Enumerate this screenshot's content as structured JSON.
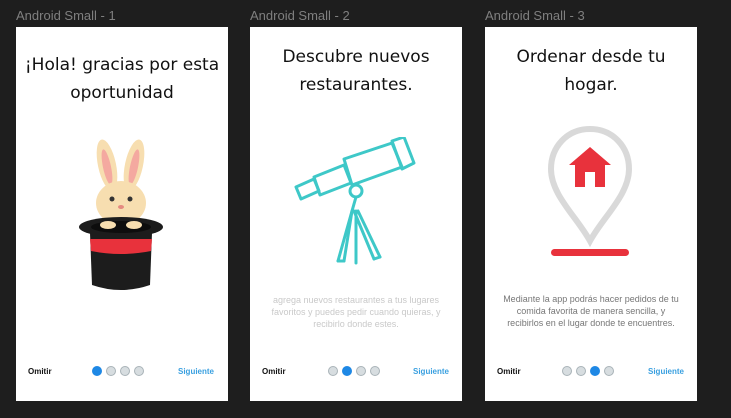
{
  "frames": [
    {
      "label": "Android Small - 1",
      "title_line1": "¡Hola! gracias por esta",
      "title_line2": "oportunidad",
      "description": "",
      "skip": "Omitir",
      "next": "Siguiente",
      "active_dot": 0,
      "icon": "rabbit-in-hat-icon"
    },
    {
      "label": "Android Small - 2",
      "title_line1": "Descubre nuevos",
      "title_line2": "restaurantes.",
      "description": "agrega nuevos restaurantes a tus lugares favoritos y puedes pedir cuando quieras, y recibirlo donde estes.",
      "skip": "Omitir",
      "next": "Siguiente",
      "active_dot": 1,
      "icon": "telescope-icon"
    },
    {
      "label": "Android Small - 3",
      "title_line1": "Ordenar desde tu",
      "title_line2": "hogar.",
      "description": "Mediante la app podrás hacer pedidos de tu comida favorita de manera sencilla, y recibirlos en el lugar donde te encuentres.",
      "skip": "Omitir",
      "next": "Siguiente",
      "active_dot": 2,
      "icon": "home-location-pin-icon"
    }
  ],
  "colors": {
    "background": "#1e1e1e",
    "frame": "#ffffff",
    "accent": "#1e88e5",
    "next_link": "#3aa0e0",
    "telescope": "#3ec8c8",
    "red": "#e8323c"
  }
}
